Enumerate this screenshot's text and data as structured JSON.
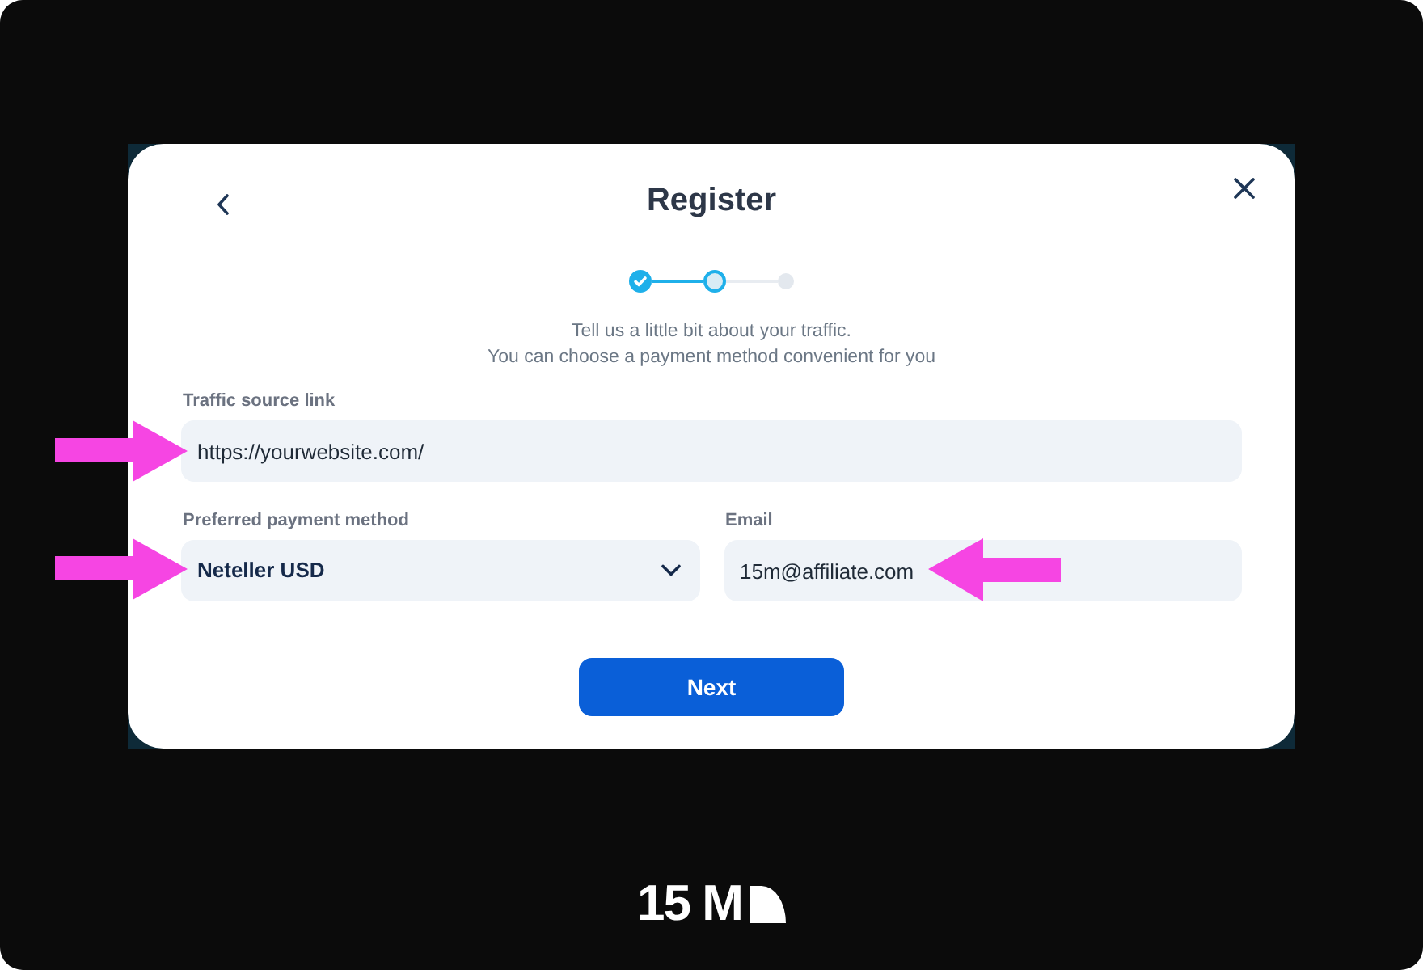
{
  "modal": {
    "title": "Register",
    "steps": [
      {
        "completed": true,
        "selected": false
      },
      {
        "completed": false,
        "selected": true
      },
      {
        "completed": false,
        "selected": false
      }
    ],
    "subtitle": [
      "Tell us a little bit about your traffic.",
      "You can choose a payment method convenient for you"
    ],
    "fields": [
      {
        "kind": "text",
        "label": "Traffic source link",
        "value": "https://yourwebsite.com/"
      },
      {
        "kind": "select",
        "label": "Preferred payment method",
        "value": "Neteller USD"
      },
      {
        "kind": "text",
        "label": "Email",
        "value": "15m@affiliate.com"
      }
    ],
    "primary_button": "Next"
  },
  "logo": {
    "text": "15 M"
  }
}
